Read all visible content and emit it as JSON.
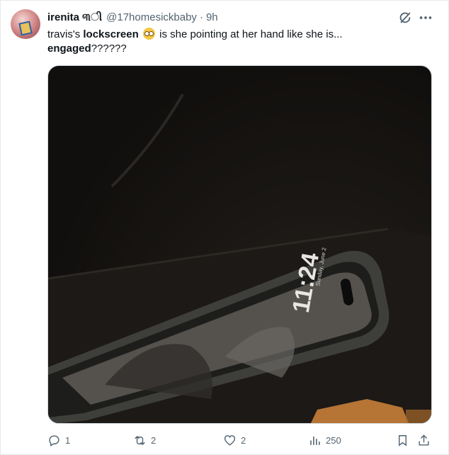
{
  "author": {
    "display_name": "irenita ୩ી",
    "handle": "@17homesickbaby",
    "separator": "·",
    "time": "9h"
  },
  "tweet": {
    "text_1": "travis's ",
    "text_bold_1": "lockscreen",
    "text_2": " is she pointing at her hand like she is...",
    "text_bold_2": "engaged",
    "text_3": "??????"
  },
  "media": {
    "phone_time": "11:24",
    "phone_date": "Sunday, June 2"
  },
  "actions": {
    "replies": "1",
    "reposts": "2",
    "likes": "2",
    "views": "250"
  },
  "icons": {
    "reply": "reply-icon",
    "repost": "repost-icon",
    "like": "heart-icon",
    "views": "views-icon",
    "bookmark": "bookmark-icon",
    "share": "share-icon",
    "grok": "grok-icon",
    "more": "more-icon"
  }
}
